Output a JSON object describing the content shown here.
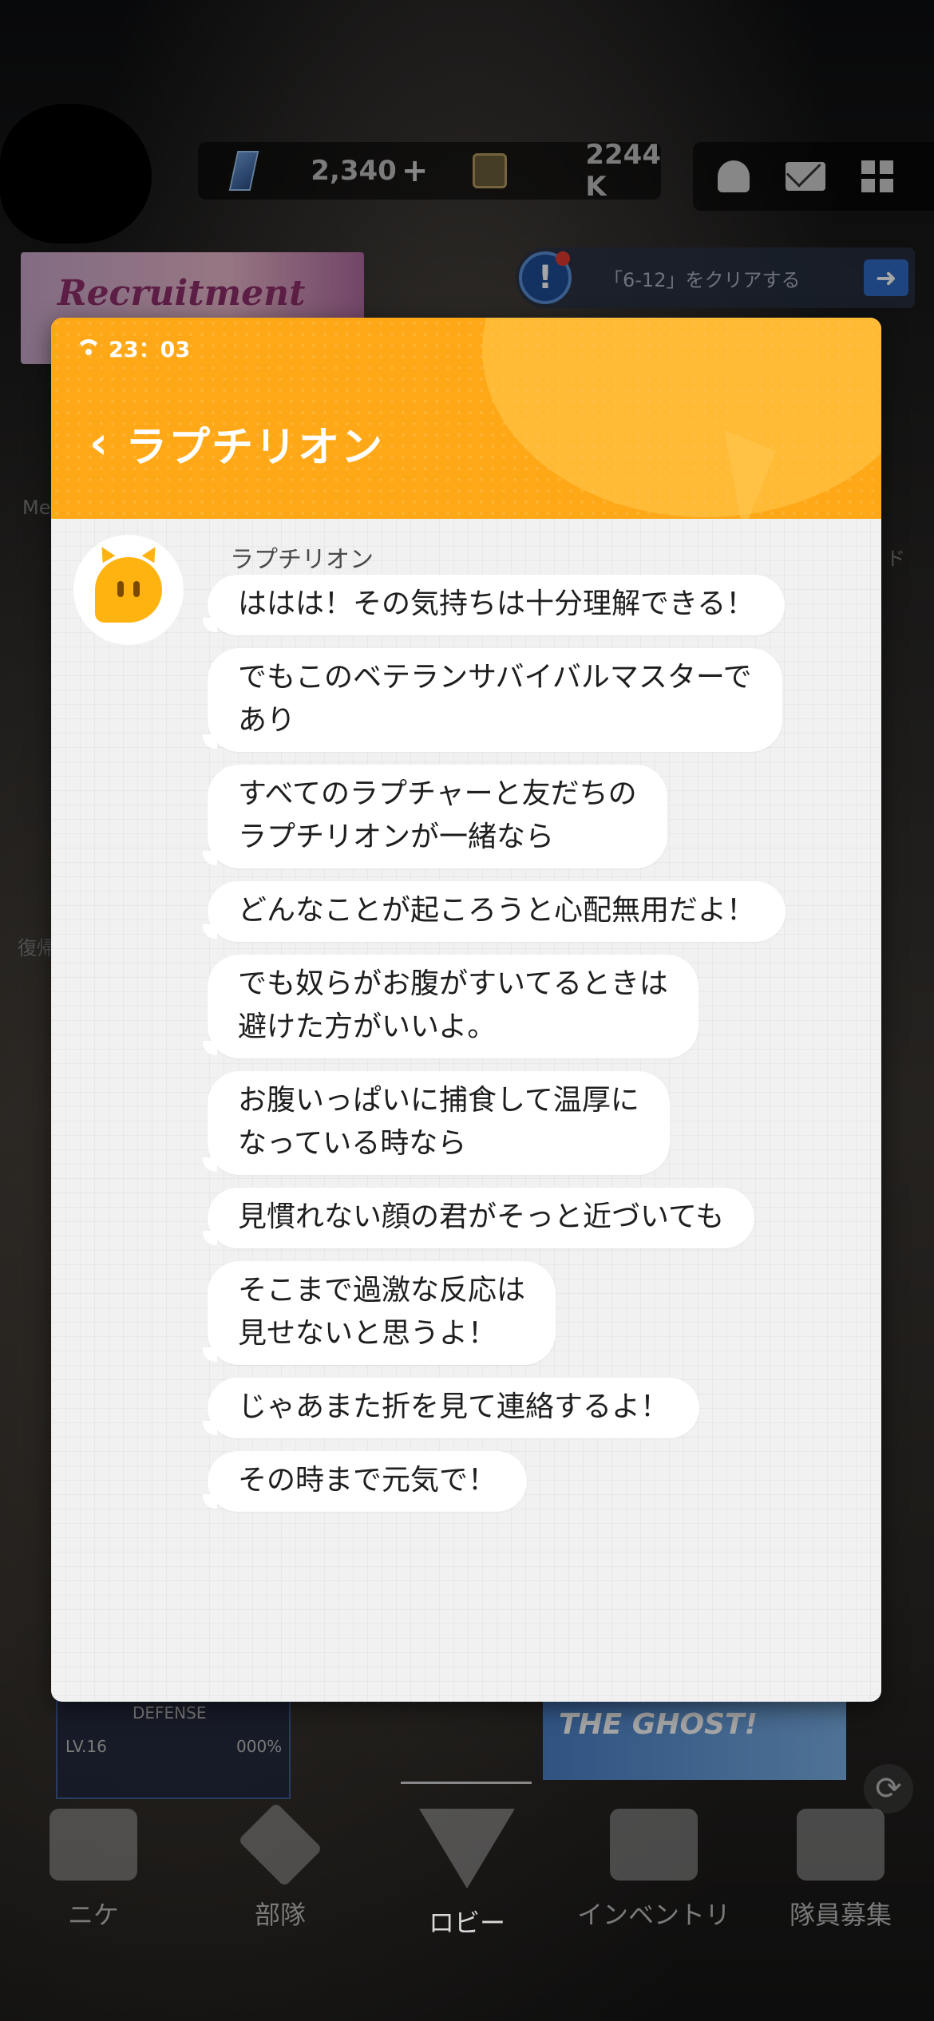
{
  "hud": {
    "gems": "2,340",
    "plus": "+",
    "credits": "2244 K"
  },
  "banner": {
    "recruit_label": "Recruitment"
  },
  "mission": {
    "text": "「6-12」をクリアする"
  },
  "side_labels": {
    "left1": "Me",
    "left2": "復帰",
    "right1": "ド"
  },
  "cards": {
    "defense_level": "LV.16",
    "defense_label": "DEFENSE",
    "defense_pct": "000%",
    "ghost_label": "THE GHOST!"
  },
  "nav": {
    "items": [
      {
        "label": "ニケ",
        "active": false
      },
      {
        "label": "部隊",
        "active": false
      },
      {
        "label": "ロビー",
        "active": true
      },
      {
        "label": "インベントリ",
        "active": false
      },
      {
        "label": "隊員募集",
        "active": false
      }
    ]
  },
  "modal": {
    "time": "23：03",
    "title": "ラプチリオン",
    "sender": "ラプチリオン",
    "messages": [
      "ははは！その気持ちは十分理解できる！",
      "でもこのベテランサバイバルマスターで\nあり",
      "すべてのラプチャーと友だちの\nラプチリオンが一緒なら",
      "どんなことが起ころうと心配無用だよ！",
      "でも奴らがお腹がすいてるときは\n避けた方がいいよ。",
      "お腹いっぱいに捕食して温厚に\nなっている時なら",
      "見慣れない顔の君がそっと近づいても",
      "そこまで過激な反応は\n見せないと思うよ！",
      "じゃあまた折を見て連絡するよ！",
      "その時まで元気で！"
    ]
  },
  "colors": {
    "header_orange": "#ffa817",
    "chat_bg": "#f1f1f1",
    "bubble": "#ffffff"
  }
}
